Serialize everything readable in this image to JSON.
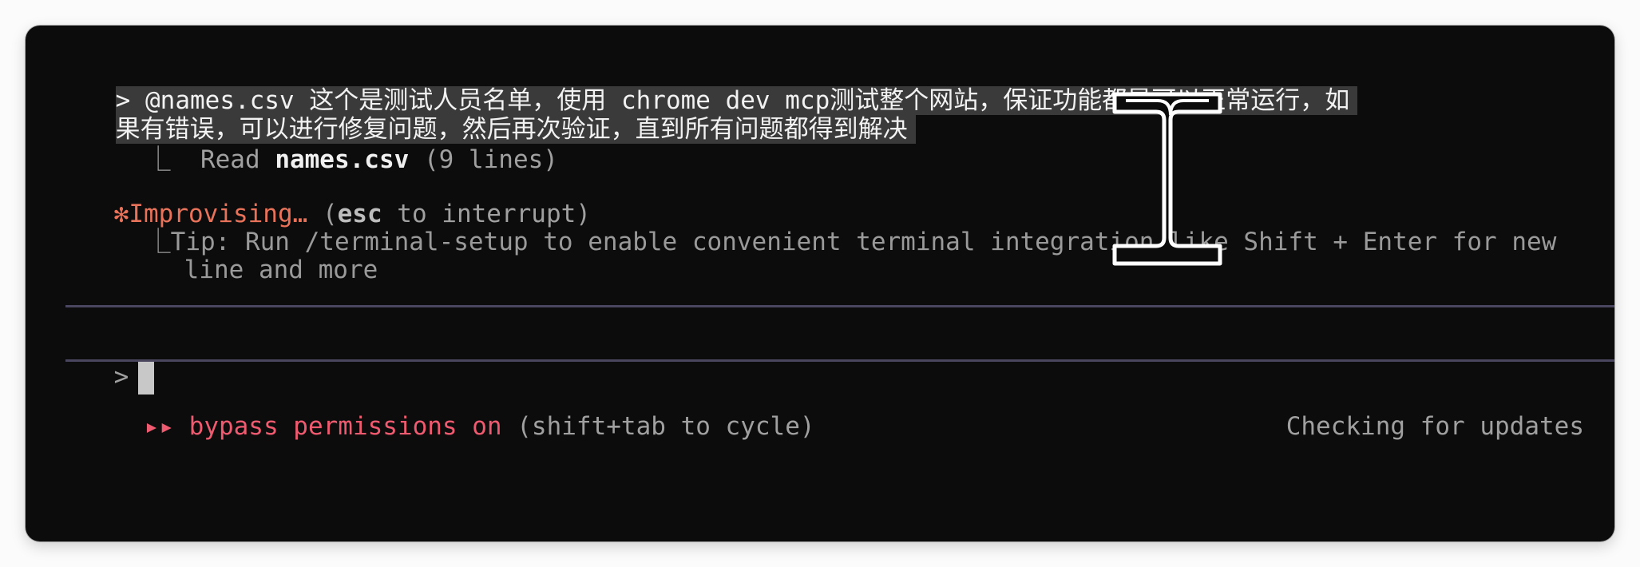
{
  "prompt": {
    "marker": ">",
    "line1": "@names.csv 这个是测试人员名单，使用 chrome dev mcp测试整个网站，保证功能都是可以正常运行，如",
    "line2": "果有错误，可以进行修复问题，然后再次验证，直到所有问题都得到解决"
  },
  "read_result": {
    "branch": "⎿",
    "verb": "Read",
    "file": "names.csv",
    "detail": "(9 lines)"
  },
  "status": {
    "spinner": "✻",
    "label": "Improvising…",
    "hint_open": "(",
    "hint_key": "esc",
    "hint_rest": " to interrupt)"
  },
  "tip": {
    "branch": "⎿",
    "line1": "Tip: Run /terminal-setup to enable convenient terminal integration like Shift + Enter for new",
    "line2": "line and more"
  },
  "input": {
    "prompt_marker": ">",
    "value": ""
  },
  "footer": {
    "arrows": "▸▸",
    "mode_label": "bypass permissions on",
    "mode_hint": "(shift+tab to cycle)",
    "update_status": "Checking for updates"
  },
  "colors": {
    "background": "#0c0c0c",
    "accent_orange": "#e8735a",
    "accent_red": "#ee5a6f",
    "divider": "#4b4660"
  },
  "icons": {
    "mouse_cursor": "i-beam-cursor-icon"
  }
}
